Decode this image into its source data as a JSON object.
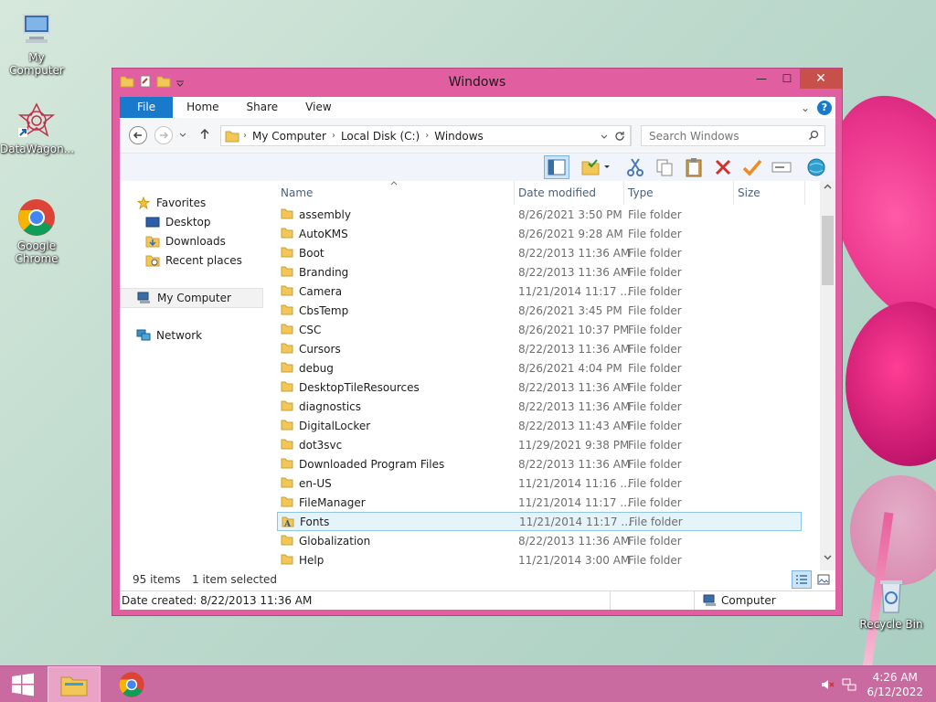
{
  "desktop": {
    "icons": [
      {
        "label": "My Computer"
      },
      {
        "label": "DataWagon..."
      },
      {
        "label": "Google Chrome"
      },
      {
        "label": "Recycle Bin"
      }
    ]
  },
  "window": {
    "title": "Windows",
    "controls": {
      "minimize": "—",
      "maximize": "☐",
      "close": "✕"
    }
  },
  "ribbon": {
    "tabs": [
      {
        "label": "File"
      },
      {
        "label": "Home"
      },
      {
        "label": "Share"
      },
      {
        "label": "View"
      }
    ],
    "help": "?",
    "expand": "⌄"
  },
  "address": {
    "breadcrumbs": [
      "My Computer",
      "Local Disk (C:)",
      "Windows"
    ],
    "search_placeholder": "Search Windows"
  },
  "nav_pane": {
    "favorites": "Favorites",
    "favorites_items": [
      "Desktop",
      "Downloads",
      "Recent places"
    ],
    "computer": "My Computer",
    "network": "Network"
  },
  "columns": {
    "name": "Name",
    "date": "Date modified",
    "type": "Type",
    "size": "Size"
  },
  "files": [
    {
      "name": "assembly",
      "date": "8/26/2021 3:50 PM",
      "type": "File folder"
    },
    {
      "name": "AutoKMS",
      "date": "8/26/2021 9:28 AM",
      "type": "File folder"
    },
    {
      "name": "Boot",
      "date": "8/22/2013 11:36 AM",
      "type": "File folder"
    },
    {
      "name": "Branding",
      "date": "8/22/2013 11:36 AM",
      "type": "File folder"
    },
    {
      "name": "Camera",
      "date": "11/21/2014 11:17 ...",
      "type": "File folder"
    },
    {
      "name": "CbsTemp",
      "date": "8/26/2021 3:45 PM",
      "type": "File folder"
    },
    {
      "name": "CSC",
      "date": "8/26/2021 10:37 PM",
      "type": "File folder"
    },
    {
      "name": "Cursors",
      "date": "8/22/2013 11:36 AM",
      "type": "File folder"
    },
    {
      "name": "debug",
      "date": "8/26/2021 4:04 PM",
      "type": "File folder"
    },
    {
      "name": "DesktopTileResources",
      "date": "8/22/2013 11:36 AM",
      "type": "File folder"
    },
    {
      "name": "diagnostics",
      "date": "8/22/2013 11:36 AM",
      "type": "File folder"
    },
    {
      "name": "DigitalLocker",
      "date": "8/22/2013 11:43 AM",
      "type": "File folder"
    },
    {
      "name": "dot3svc",
      "date": "11/29/2021 9:38 PM",
      "type": "File folder"
    },
    {
      "name": "Downloaded Program Files",
      "date": "8/22/2013 11:36 AM",
      "type": "File folder"
    },
    {
      "name": "en-US",
      "date": "11/21/2014 11:16 ...",
      "type": "File folder"
    },
    {
      "name": "FileManager",
      "date": "11/21/2014 11:17 ...",
      "type": "File folder"
    },
    {
      "name": "Fonts",
      "date": "11/21/2014 11:17 ...",
      "type": "File folder",
      "selected": true
    },
    {
      "name": "Globalization",
      "date": "8/22/2013 11:36 AM",
      "type": "File folder"
    },
    {
      "name": "Help",
      "date": "11/21/2014 3:00 AM",
      "type": "File folder"
    }
  ],
  "status": {
    "items_count": "95 items",
    "selected_count": "1 item selected",
    "details": "Date created: 8/22/2013 11:36 AM",
    "location": "Computer"
  },
  "taskbar": {
    "time": "4:26 AM",
    "date": "6/12/2022"
  },
  "colors": {
    "window_frame": "#e15ea0",
    "file_tab": "#1979ca",
    "selection": "#e5f3fb",
    "taskbar": "#c96aa0"
  }
}
